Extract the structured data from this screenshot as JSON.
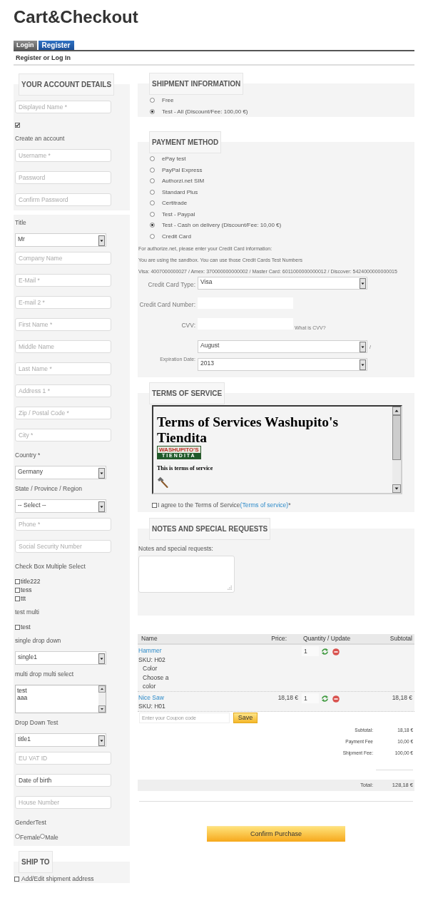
{
  "page": {
    "title": "Cart&Checkout"
  },
  "tabs": [
    {
      "label": "Login",
      "selected": false
    },
    {
      "label": "Register",
      "selected": true
    }
  ],
  "tab_heading": "Register or Log In",
  "account": {
    "legend": "YOUR ACCOUNT DETAILS",
    "fields": [
      {
        "kind": "input",
        "placeholder": "Displayed Name *"
      },
      {
        "kind": "checkbox",
        "checked": true
      },
      {
        "kind": "label",
        "text": "Create an account"
      },
      {
        "kind": "input",
        "placeholder": "Username *"
      },
      {
        "kind": "input",
        "placeholder": "Password"
      },
      {
        "kind": "input",
        "placeholder": "Confirm Password"
      }
    ]
  },
  "address": {
    "fields": [
      {
        "kind": "label",
        "text": "Title"
      },
      {
        "kind": "select",
        "value": "Mr"
      },
      {
        "kind": "input",
        "placeholder": "Company Name"
      },
      {
        "kind": "input",
        "placeholder": "E-Mail *"
      },
      {
        "kind": "input",
        "placeholder": "E-mail 2 *"
      },
      {
        "kind": "input",
        "placeholder": "First Name *"
      },
      {
        "kind": "input",
        "placeholder": "Middle Name"
      },
      {
        "kind": "input",
        "placeholder": "Last Name *"
      },
      {
        "kind": "input",
        "placeholder": "Address 1 *"
      },
      {
        "kind": "input",
        "placeholder": "Zip / Postal Code *"
      },
      {
        "kind": "input",
        "placeholder": "City *"
      },
      {
        "kind": "label",
        "text": "Country *"
      },
      {
        "kind": "select",
        "value": "Germany"
      },
      {
        "kind": "label",
        "text": "State / Province / Region"
      },
      {
        "kind": "select",
        "value": "-- Select --"
      },
      {
        "kind": "input",
        "placeholder": "Phone *"
      },
      {
        "kind": "input",
        "placeholder": "Social Security Number"
      },
      {
        "kind": "label",
        "text": "Check Box Multiple Select"
      },
      {
        "kind": "checklist",
        "items": [
          {
            "label": "title222",
            "checked": false
          },
          {
            "label": "tess",
            "checked": false
          },
          {
            "label": "ttt",
            "checked": false
          }
        ]
      },
      {
        "kind": "label",
        "text": "test multi"
      },
      {
        "kind": "checklist",
        "items": [
          {
            "label": "test",
            "checked": false
          }
        ]
      },
      {
        "kind": "label",
        "text": "single drop down"
      },
      {
        "kind": "select",
        "value": "single1"
      },
      {
        "kind": "label",
        "text": "multi drop multi select"
      },
      {
        "kind": "listbox",
        "options": [
          "test",
          "aaa"
        ]
      },
      {
        "kind": "label",
        "text": "Drop Down Test"
      },
      {
        "kind": "select",
        "value": "title1"
      },
      {
        "kind": "input",
        "placeholder": "EU VAT ID"
      },
      {
        "kind": "input",
        "value": "Date of birth"
      },
      {
        "kind": "input",
        "placeholder": "House Number"
      },
      {
        "kind": "label",
        "text": "GenderTest"
      },
      {
        "kind": "radios",
        "items": [
          {
            "label": "Female",
            "selected": false
          },
          {
            "label": "Male",
            "selected": false
          }
        ]
      }
    ]
  },
  "ship_to": {
    "legend": "SHIP TO",
    "checkbox": {
      "label": "Add/Edit shipment address",
      "checked": false
    }
  },
  "shipment": {
    "legend": "SHIPMENT INFORMATION",
    "options": [
      {
        "label": "Free",
        "selected": false
      },
      {
        "label": "Test - All (Discount/Fee: 100,00 €)",
        "selected": true
      }
    ]
  },
  "payment": {
    "legend": "PAYMENT METHOD",
    "options": [
      {
        "label": "ePay test",
        "selected": false
      },
      {
        "label": "PayPal Express",
        "selected": false
      },
      {
        "label": "Authorzi.net SIM",
        "selected": false
      },
      {
        "label": "Standard Plus",
        "selected": false
      },
      {
        "label": "Certitrade",
        "selected": false
      },
      {
        "label": "Test - Paypal",
        "selected": false
      },
      {
        "label": "Test - Cash on delivery (Discount/Fee: 10,00 €)",
        "selected": true
      },
      {
        "label": "Credit Card",
        "selected": false
      }
    ],
    "info_lines": [
      "For authorize.net, please enter your Credit Card information:",
      "You are using the sandbox. You can use those Credit Cards Test Numbers",
      "Visa: 4007000000027 / Amex: 370000000000002 / Master Card: 6011000000000012 / Discover: 5424000000000015"
    ],
    "credit_card": {
      "type_label": "Credit Card Type:",
      "type_value": "Visa",
      "number_label": "Credit Card Number:",
      "cvv_label": "CVV:",
      "cvv_help": "What is CVV?",
      "expiration_label": "Expiration Date:",
      "month": "August",
      "separator": "/",
      "year": "2013"
    }
  },
  "terms": {
    "legend": "TERMS OF SERVICE",
    "document": {
      "heading": "Terms of Services Washupito's Tiendita",
      "logo": {
        "name": "WASHUPITO'S",
        "tagline": "TIENDITA"
      },
      "body": "This is terms of service"
    },
    "agree": {
      "checked": false,
      "text": "I agree to the Terms of Service",
      "link": "(Terms of service)",
      "suffix": "*"
    }
  },
  "special_requests": {
    "legend": "NOTES AND SPECIAL REQUESTS",
    "label": "Notes and special requests:"
  },
  "cart": {
    "columns": [
      "Name",
      "Price:",
      "Quantity / Update",
      "Subtotal"
    ],
    "rows": [
      {
        "name": "Hammer",
        "sku": "SKU: H02",
        "attributes": [
          {
            "name": "Color",
            "value": "Choose a color"
          }
        ],
        "quantity": "1"
      },
      {
        "name": "Nice Saw",
        "sku": "SKU: H01",
        "price": "18,18 €",
        "quantity": "1",
        "subtotal": "18,18 €"
      }
    ],
    "coupon": {
      "placeholder": "Enter your Coupon code",
      "button": "Save"
    },
    "summary": [
      {
        "label": "Subtotal:",
        "value": "18,18 €"
      },
      {
        "label": "Payment Fee",
        "value": "10,00 €"
      },
      {
        "label": "Shipment Fee:",
        "value": "100,00 €"
      }
    ],
    "total": {
      "label": "Total:",
      "value": "128,18 €"
    }
  },
  "confirm_button": "Confirm Purchase"
}
